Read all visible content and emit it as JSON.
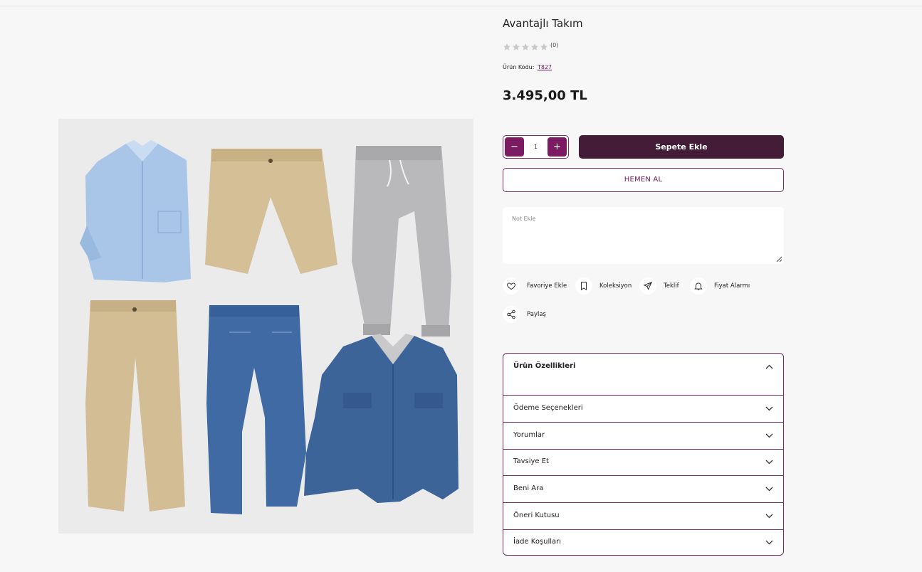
{
  "product": {
    "title": "Avantajlı Takım",
    "rating_count": "(0)",
    "code_label": "Ürün Kodu:",
    "code_value": "T827",
    "price": "3.495,00 TL"
  },
  "purchase": {
    "minus": "−",
    "quantity": "1",
    "plus": "+",
    "add_to_cart": "Sepete Ekle",
    "buy_now": "HEMEN AL",
    "note_placeholder": "Not Ekle"
  },
  "actions": [
    {
      "label": "Favoriye Ekle",
      "icon": "heart-icon"
    },
    {
      "label": "Koleksiyon",
      "icon": "bookmark-icon"
    },
    {
      "label": "Teklif",
      "icon": "send-icon"
    },
    {
      "label": "Fiyat Alarmı",
      "icon": "bell-icon"
    },
    {
      "label": "Paylaş",
      "icon": "share-icon"
    }
  ],
  "accordion": [
    {
      "label": "Ürün Özellikleri",
      "expanded": true
    },
    {
      "label": "Ödeme Seçenekleri"
    },
    {
      "label": "Yorumlar"
    },
    {
      "label": "Tavsiye Et"
    },
    {
      "label": "Beni Ara"
    },
    {
      "label": "Öneri Kutusu"
    },
    {
      "label": "İade Koşulları"
    }
  ],
  "colors": {
    "accent": "#7b1c63",
    "cart_button": "#431d37",
    "border": "#7a2a63"
  }
}
